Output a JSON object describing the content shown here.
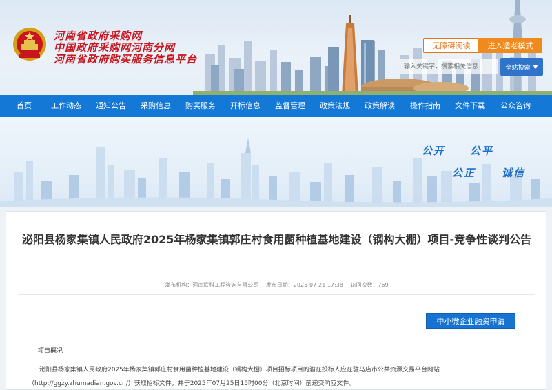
{
  "header": {
    "site_titles": [
      "河南省政府采购网",
      "中国政府采购网河南分网",
      "河南省政府购买服务信息平台"
    ],
    "accessibility_label": "无障碍阅读",
    "elder_mode_label": "进入适老模式",
    "search_placeholder": "输入关键字，搜索相关信息",
    "search_button_label": "全站搜索"
  },
  "nav": {
    "items": [
      "首页",
      "工作动态",
      "通知公告",
      "采购信息",
      "购买服务",
      "开标信息",
      "监督管理",
      "政策法规",
      "政策解读",
      "操作指南",
      "文件下载",
      "公众咨询"
    ]
  },
  "banner": {
    "slogans": [
      "公开",
      "公平",
      "公正",
      "诚信"
    ]
  },
  "article": {
    "title": "泌阳县杨家集镇人民政府2025年杨家集镇郭庄村食用菌种植基地建设（钢构大棚）项目-竞争性谈判公告",
    "publisher": "发布机构：河南联科工程咨询有限公司",
    "publish_date": "发布日期：2025-07-21 17:38",
    "view_count": "访问次数：769",
    "finance_button_label": "中小微企业融资申请",
    "section_label": "项目概况",
    "paragraph": "泌阳县杨家集镇人民政府2025年杨家集镇郭庄村食用菌种植基地建设（钢构大棚）项目招标项目的潜在投标人应在驻马店市公共资源交易平台网站（http://ggzy.zhumadian.gov.cn/）获取招标文件，并于2025年07月25日15时00分（北京时间）前递交响应文件。"
  },
  "colors": {
    "nav_blue": "#1478d6",
    "title_red": "#c8161e",
    "accent_orange": "#f08a1c"
  }
}
